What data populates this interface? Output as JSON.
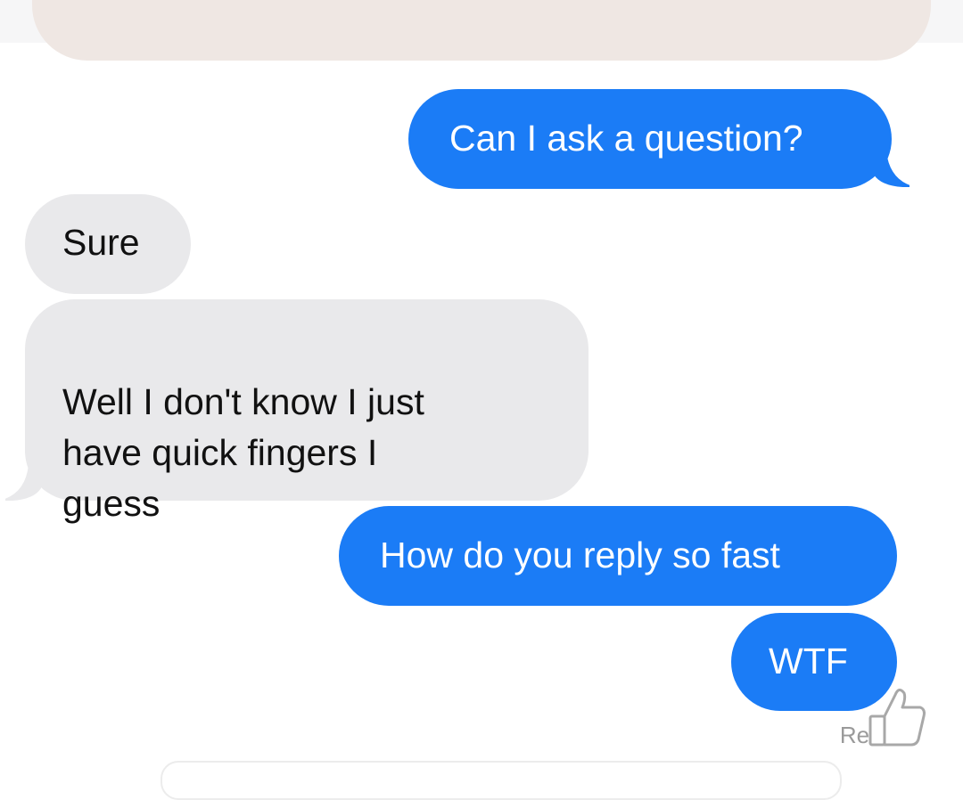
{
  "thread": {
    "messages": [
      {
        "direction": "sent",
        "text": "Can I ask a question?"
      },
      {
        "direction": "received",
        "text": "Sure"
      },
      {
        "direction": "received",
        "text": "Well I don't know I just\nhave quick fingers I\nguess"
      },
      {
        "direction": "sent",
        "text": "How do you reply so fast"
      },
      {
        "direction": "sent",
        "text": "WTF"
      }
    ],
    "read_receipt": "Read"
  },
  "colors": {
    "sent_bubble": "#1b7cf6",
    "received_bubble": "#e9e9eb",
    "previous_card": "#efe7e3",
    "read_receipt": "#9a9a9a"
  },
  "icons": {
    "reaction": "thumbs-up-icon"
  }
}
